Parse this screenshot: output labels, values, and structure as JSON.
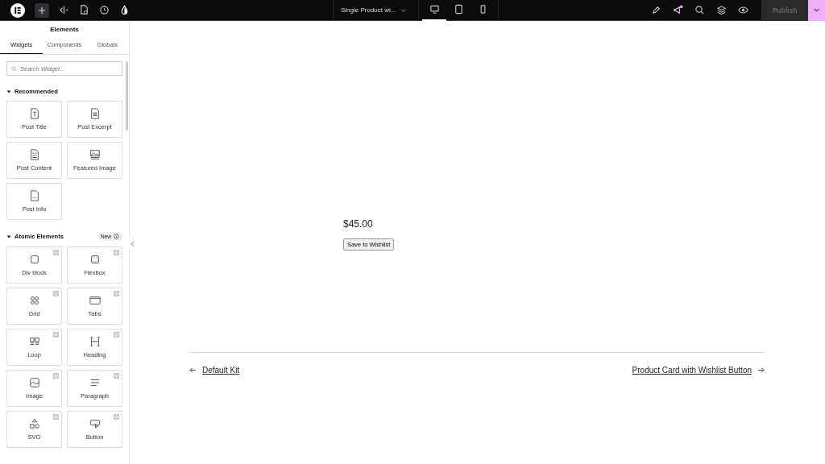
{
  "top_bar": {
    "document_title": "Single Product wi...",
    "devices": [
      {
        "kind": "desktop",
        "selected": true
      },
      {
        "kind": "tablet",
        "selected": false
      },
      {
        "kind": "mobile",
        "selected": false
      }
    ],
    "notification": true,
    "publish": {
      "label": "Publish",
      "disabled": true
    }
  },
  "panel": {
    "title": "Elements",
    "tabs": [
      {
        "label": "Widgets",
        "selected": true
      },
      {
        "label": "Components",
        "selected": false
      },
      {
        "label": "Globals",
        "selected": false
      }
    ],
    "search": {
      "placeholder": "Search Widget..."
    },
    "sections": [
      {
        "title": "Recommended",
        "expanded": true,
        "items": [
          {
            "label": "Post Title",
            "kind": "title"
          },
          {
            "label": "Post Excerpt",
            "kind": "excerpt"
          },
          {
            "label": "Post Content",
            "kind": "content"
          },
          {
            "label": "Featured Image",
            "kind": "featured"
          },
          {
            "label": "Post Info",
            "kind": "info"
          }
        ]
      },
      {
        "title": "Atomic Elements",
        "expanded": true,
        "badge": "New",
        "corner_icons": true,
        "items": [
          {
            "label": "Div block",
            "kind": "div"
          },
          {
            "label": "Flexbox",
            "kind": "flexbox"
          },
          {
            "label": "Grid",
            "kind": "grid"
          },
          {
            "label": "Tabs",
            "kind": "tabs"
          },
          {
            "label": "Loop",
            "kind": "loop"
          },
          {
            "label": "Heading",
            "kind": "heading"
          },
          {
            "label": "Image",
            "kind": "image"
          },
          {
            "label": "Paragraph",
            "kind": "paragraph"
          },
          {
            "label": "SVG",
            "kind": "svg"
          },
          {
            "label": "Button",
            "kind": "button"
          }
        ]
      }
    ]
  },
  "canvas": {
    "price": "$45.00",
    "wishlist_button": "Save to Wishlist",
    "prev_link": "Default Kit",
    "next_link": "Product Card with Wishlist Button"
  }
}
